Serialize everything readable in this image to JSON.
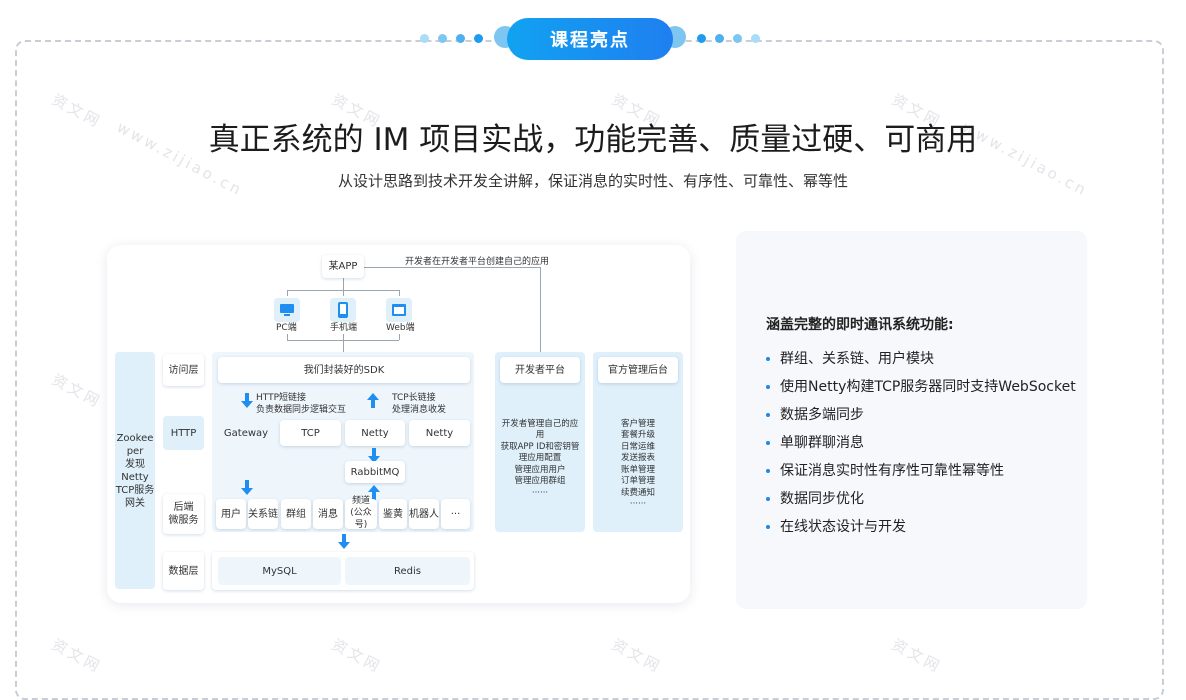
{
  "header": {
    "badge_label": "课程亮点",
    "headline": "真正系统的 IM 项目实战，功能完善、质量过硬、可商用",
    "subline": "从设计思路到技术开发全讲解，保证消息的实时性、有序性、可靠性、幂等性"
  },
  "watermark": {
    "line1": "资文网",
    "line2": "www.zijiao.cn"
  },
  "diagram": {
    "app": "某APP",
    "dev_note": "开发者在开发者平台创建自己的应用",
    "clients": [
      "PC端",
      "手机端",
      "Web端"
    ],
    "side_left": "Zookeeper发现Netty TCP服务网关",
    "side_left_lines": [
      "Zookee",
      "per",
      "发现",
      "Netty",
      "TCP服务",
      "网关"
    ],
    "layers": {
      "access": "访问层",
      "http": "HTTP",
      "backend": "后端\n微服务",
      "backend_lines": [
        "后端",
        "微服务"
      ],
      "data": "数据层"
    },
    "sdk": "我们封装好的SDK",
    "http_note": [
      "HTTP短链接",
      "负责数据同步逻辑交互"
    ],
    "tcp_note": [
      "TCP长链接",
      "处理消息收发"
    ],
    "gateway_row": [
      "Gateway",
      "TCP",
      "Netty",
      "Netty"
    ],
    "mq": "RabbitMQ",
    "services": [
      "用户",
      "关系链",
      "群组",
      "消息",
      "频道\n(公众号)",
      "鉴黄",
      "机器人",
      "···"
    ],
    "channel_lines": [
      "频道",
      "(公众号)"
    ],
    "db": [
      "MySQL",
      "Redis"
    ],
    "dev_platform": {
      "title": "开发者平台",
      "items": [
        "开发者管理自己的应",
        "用",
        "获取APP ID和密钥管",
        "理应用配置",
        "管理应用用户",
        "管理应用群组",
        "······"
      ]
    },
    "admin": {
      "title": "官方管理后台",
      "items": [
        "客户管理",
        "套餐升级",
        "日常运维",
        "发送报表",
        "账单管理",
        "订单管理",
        "续费通知",
        "······"
      ]
    }
  },
  "features": {
    "title": "涵盖完整的即时通讯系统功能:",
    "items": [
      "群组、关系链、用户模块",
      "使用Netty构建TCP服务器同时支持WebSocket",
      "数据多端同步",
      "单聊群聊消息",
      "保证消息实时性有序性可靠性幂等性",
      "数据同步优化",
      "在线状态设计与开发"
    ]
  },
  "colors": {
    "accent": "#1f8ef1",
    "light_blue": "#dff0fb",
    "panel_bg": "#f6f8fb"
  }
}
